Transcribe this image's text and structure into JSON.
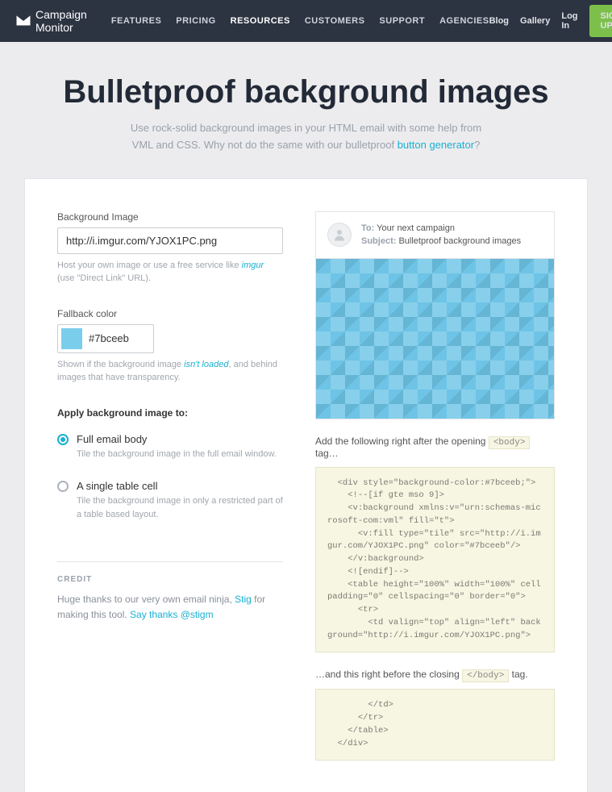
{
  "brand": "Campaign Monitor",
  "nav": {
    "features": "FEATURES",
    "pricing": "PRICING",
    "resources": "RESOURCES",
    "customers": "CUSTOMERS",
    "support": "SUPPORT",
    "agencies": "AGENCIES"
  },
  "rightnav": {
    "blog": "Blog",
    "gallery": "Gallery",
    "login": "Log In",
    "signup": "SIGN UP"
  },
  "hero": {
    "title": "Bulletproof background images",
    "sub1": "Use rock-solid background images in your HTML email with some help from",
    "sub2": "VML and CSS. Why not do the same with our bulletproof ",
    "link": "button generator",
    "q": "?"
  },
  "form": {
    "bgimage_label": "Background Image",
    "bgimage_value": "http://i.imgur.com/YJOX1PC.png",
    "bgimage_hint1": "Host your own image or use a free service like ",
    "bgimage_hint_link": "imgur",
    "bgimage_hint2": " (use \"Direct Link\" URL).",
    "fallback_label": "Fallback color",
    "fallback_value": "#7bceeb",
    "fallback_hint1": "Shown if the background image ",
    "fallback_hint_link": "isn't loaded",
    "fallback_hint2": ", and behind images that have transparency.",
    "apply_title": "Apply background image to:",
    "opt1_label": "Full email body",
    "opt1_desc": "Tile the background image in the full email window.",
    "opt2_label": "A single table cell",
    "opt2_desc": "Tile the background image in only a restricted part of a table based layout."
  },
  "preview": {
    "to_label": "To:",
    "to_value": "Your next campaign",
    "subject_label": "Subject:",
    "subject_value": "Bulletproof background images"
  },
  "code": {
    "instr1a": "Add the following right after the opening ",
    "tag_body_open": "<body>",
    "instr1b": " tag…",
    "block1": "  <div style=\"background-color:#7bceeb;\">\n    <!--[if gte mso 9]>\n    <v:background xmlns:v=\"urn:schemas-microsoft-com:vml\" fill=\"t\">\n      <v:fill type=\"tile\" src=\"http://i.imgur.com/YJOX1PC.png\" color=\"#7bceeb\"/>\n    </v:background>\n    <![endif]-->\n    <table height=\"100%\" width=\"100%\" cellpadding=\"0\" cellspacing=\"0\" border=\"0\">\n      <tr>\n        <td valign=\"top\" align=\"left\" background=\"http://i.imgur.com/YJOX1PC.png\">",
    "instr2a": "…and this right before the closing ",
    "tag_body_close": "</body>",
    "instr2b": " tag.",
    "block2": "        </td>\n      </tr>\n    </table>\n  </div>"
  },
  "credit": {
    "title": "CREDIT",
    "t1": "Huge thanks to our very own email ninja, ",
    "link1": "Stig",
    "t2": " for making this tool. ",
    "link2": "Say thanks @stigm"
  }
}
